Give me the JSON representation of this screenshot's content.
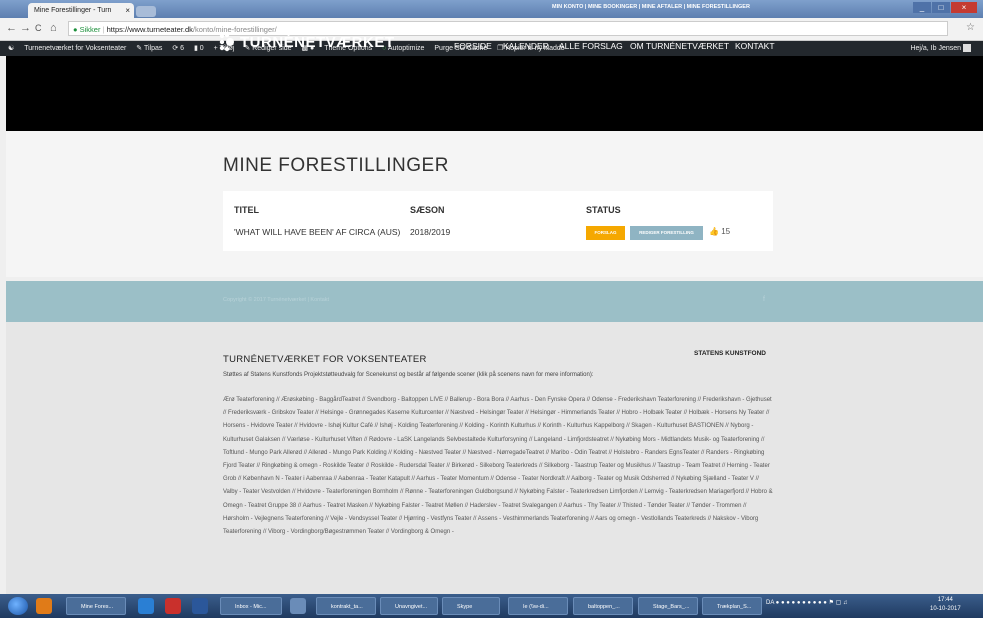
{
  "browser": {
    "tab_title": "Mine Forestillinger - Turn",
    "tab_close": "×",
    "url_secure": "Sikker",
    "url_host": "https://www.turneteater.dk",
    "url_path": "/konto/mine-forestillinger/",
    "back": "←",
    "forward": "→",
    "reload": "C",
    "home": "⌂",
    "star": "☆",
    "win_min": "_",
    "win_max": "□",
    "win_close": "×"
  },
  "adminbar": {
    "items": [
      "Turnenetværket for Voksenteater",
      "Tilpas",
      "6",
      "0",
      "Tilføj",
      "Rediger side",
      "Theme Options",
      "Autoptimize",
      "Purge SG Cache",
      "Kopier til ny kladde"
    ],
    "user": "Hej/a, Ib Jensen"
  },
  "header": {
    "top_menu": "MIN KONTO  |  MINE BOOKINGER  |  MINE AFTALER  |  MINE FORESTILLINGER",
    "logo": "TURNÉNETVÆRKET",
    "nav": [
      "FORSIDE",
      "KALENDER",
      "ALLE FORSLAG",
      "OM TURNÉNETVÆRKET",
      "KONTAKT"
    ]
  },
  "main": {
    "title": "MINE FORESTILLINGER",
    "columns": [
      "TITEL",
      "SÆSON",
      "STATUS"
    ],
    "row": {
      "title": "'WHAT WILL HAVE BEEN' AF CIRCA (AUS)",
      "season": "2018/2019",
      "status_badge": "FORSLAG",
      "edit_button": "REDIGER FORESTILLING",
      "likes": "15"
    }
  },
  "band": {
    "copyright": "Copyright © 2017 Turnénetværket | Kontakt",
    "social": "f"
  },
  "footer": {
    "heading": "TURNÉNETVÆRKET FOR VOKSENTEATER",
    "sponsor": "STATENS KUNSTFOND",
    "intro": "Støttes af Statens Kunstfonds Projektstøtteudvalg for Scenekunst og består af følgende scener (klik på scenens navn for mere information):",
    "venues": "Ærø Teaterforening // Ærøskøbing - BaggårdTeatret // Svendborg - Baltoppen LIVE // Ballerup - Bora Bora // Aarhus - Den Fynske Opera // Odense - Frederikshavn Teaterforening // Frederikshavn - Gjethuset // Frederiksværk - Gribskov Teater // Helsinge - Grønnegades Kaserne Kulturcenter // Næstved - Helsingør Teater // Helsingør - Himmerlands Teater // Hobro - Holbæk Teater // Holbæk - Horsens Ny Teater // Horsens - Hvidovre Teater // Hvidovre - Ishøj Kultur Café // Ishøj - Kolding Teaterforening // Kolding - Korinth Kulturhus // Korinth - Kulturhus Kappelborg // Skagen - Kulturhuset BASTIONEN // Nyborg - Kulturhuset Galaksen // Værløse - Kulturhuset Viften // Rødovre - LaSK Langelands Selvbestaltede Kulturforsyning // Langeland - Limfjordsteatret // Nykøbing Mors - Midtlandets Musik- og Teaterforening // Toftlund - Mungo Park Allerød // Allerød - Mungo Park Kolding // Kolding - Næstved Teater // Næstved - NørregadeTeatret // Maribo - Odin Teatret // Holstebro - Randers EgnsTeater // Randers - Ringkøbing Fjord Teater // Ringkøbing & omegn - Roskilde Teater // Roskilde - Rudersdal Teater // Birkerød - Silkeborg Teaterkreds // Silkeborg - Taastrup Teater og Musikhus // Taastrup - Team Teatret // Herning - Teater Grob // København N - Teater i Aabenraa // Aabenraa - Teater Katapult // Aarhus - Teater Momentum // Odense - Teater Nordkraft // Aalborg - Teater og Musik Odsherred // Nykøbing Sjælland - Teater V // Valby - Teater Vestvolden // Hvidovre - Teaterforeningen Bornholm // Rønne - Teaterforeningen Guldborgsund // Nykøbing Falster - Teaterkredsen Limfjorden // Lemvig - Teaterkredsen Mariagerfjord // Hobro & Omegn - Teatret Gruppe 38 // Aarhus - Teatret Masken // Nykøbing Falster - Teatret Møllen // Haderslev - Teatret Svalegangen // Aarhus - Thy Teater // Thisted - Tønder Teater // Tønder - Trommen // Hørsholm - Vejlegnens Teaterforening // Vejle - Vendsyssel Teater // Hjørring - Vestfyns Teater // Assens - Vesthimmerlands Teaterforening // Aars og omegn - Vestlollands Teaterkreds // Nakskov - Viborg Teaterforening // Viborg - Vordingborg/Bøgestrømmen Teater // Vordingborg & Omegn -"
  },
  "taskbar": {
    "buttons": [
      "Mine Fores...",
      "Inbox - Mic...",
      "kontrakt_ta...",
      "Unavngivet...",
      "Skype",
      "Ie (\\\\w-di...",
      "baltoppen_...",
      "Stage_Bars_...",
      "Trækplan_S..."
    ],
    "lang": "DA",
    "time": "17:44",
    "date": "10-10-2017"
  },
  "colors": {
    "accent_orange": "#f5a800",
    "accent_teal": "#8fb4c3",
    "band_teal": "#9bbfc7",
    "header_black": "#000000"
  }
}
